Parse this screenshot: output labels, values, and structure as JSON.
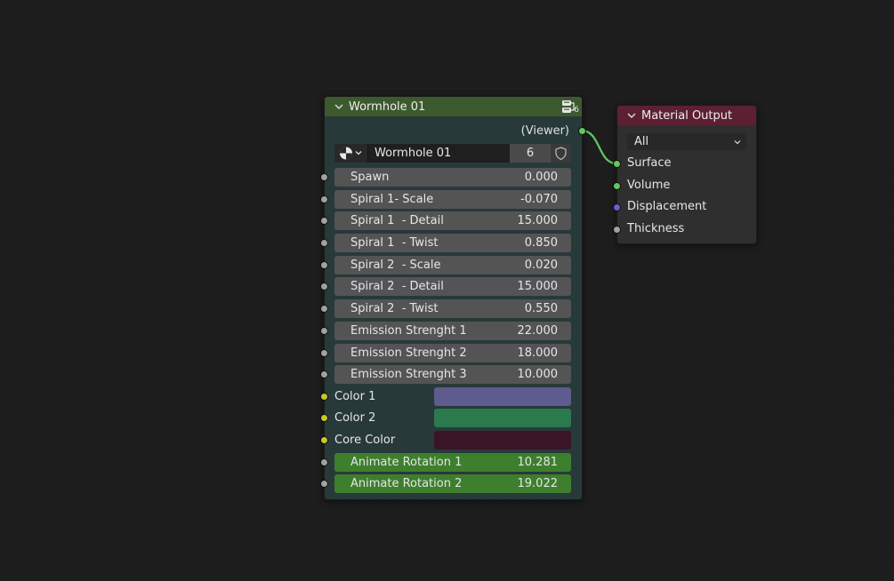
{
  "group_node": {
    "title": "Wormhole 01",
    "user_count": "6",
    "output_socket_label": "(Viewer)",
    "datablock": {
      "name": "Wormhole 01",
      "users": "6"
    },
    "inputs": [
      {
        "label": "Spawn",
        "value": "0.000"
      },
      {
        "label": "Spiral 1- Scale",
        "value": "-0.070"
      },
      {
        "label": "Spiral 1  - Detail",
        "value": "15.000"
      },
      {
        "label": "Spiral 1  - Twist",
        "value": "0.850"
      },
      {
        "label": "Spiral 2  - Scale",
        "value": "0.020"
      },
      {
        "label": "Spiral 2  - Detail",
        "value": "15.000"
      },
      {
        "label": "Spiral 2  - Twist",
        "value": "0.550"
      },
      {
        "label": "Emission Strenght 1",
        "value": "22.000"
      },
      {
        "label": "Emission Strenght 2",
        "value": "18.000"
      },
      {
        "label": "Emission Strenght 3",
        "value": "10.000"
      }
    ],
    "color_inputs": [
      {
        "label": "Color 1",
        "color": "#5e5b8e"
      },
      {
        "label": "Color 2",
        "color": "#2a7a4d"
      },
      {
        "label": "Core Color",
        "color": "#3a1528"
      }
    ],
    "animate_inputs": [
      {
        "label": "Animate Rotation 1",
        "value": "10.281"
      },
      {
        "label": "Animate Rotation 2",
        "value": "19.022"
      }
    ]
  },
  "output_node": {
    "title": "Material Output",
    "target": "All",
    "inputs": [
      {
        "label": "Surface"
      },
      {
        "label": "Volume"
      },
      {
        "label": "Displacement"
      },
      {
        "label": "Thickness"
      }
    ]
  },
  "colors": {
    "group_header": "#3c5a2e",
    "output_header": "#5c2032",
    "link": "#63c763"
  }
}
